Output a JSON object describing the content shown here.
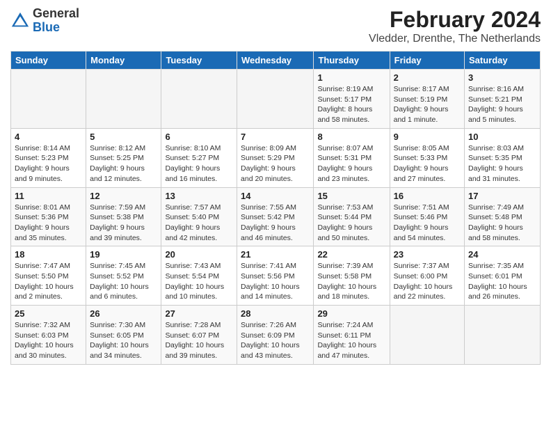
{
  "header": {
    "logo_general": "General",
    "logo_blue": "Blue",
    "title": "February 2024",
    "subtitle": "Vledder, Drenthe, The Netherlands"
  },
  "calendar": {
    "columns": [
      "Sunday",
      "Monday",
      "Tuesday",
      "Wednesday",
      "Thursday",
      "Friday",
      "Saturday"
    ],
    "weeks": [
      [
        {
          "day": "",
          "info": ""
        },
        {
          "day": "",
          "info": ""
        },
        {
          "day": "",
          "info": ""
        },
        {
          "day": "",
          "info": ""
        },
        {
          "day": "1",
          "info": "Sunrise: 8:19 AM\nSunset: 5:17 PM\nDaylight: 8 hours\nand 58 minutes."
        },
        {
          "day": "2",
          "info": "Sunrise: 8:17 AM\nSunset: 5:19 PM\nDaylight: 9 hours\nand 1 minute."
        },
        {
          "day": "3",
          "info": "Sunrise: 8:16 AM\nSunset: 5:21 PM\nDaylight: 9 hours\nand 5 minutes."
        }
      ],
      [
        {
          "day": "4",
          "info": "Sunrise: 8:14 AM\nSunset: 5:23 PM\nDaylight: 9 hours\nand 9 minutes."
        },
        {
          "day": "5",
          "info": "Sunrise: 8:12 AM\nSunset: 5:25 PM\nDaylight: 9 hours\nand 12 minutes."
        },
        {
          "day": "6",
          "info": "Sunrise: 8:10 AM\nSunset: 5:27 PM\nDaylight: 9 hours\nand 16 minutes."
        },
        {
          "day": "7",
          "info": "Sunrise: 8:09 AM\nSunset: 5:29 PM\nDaylight: 9 hours\nand 20 minutes."
        },
        {
          "day": "8",
          "info": "Sunrise: 8:07 AM\nSunset: 5:31 PM\nDaylight: 9 hours\nand 23 minutes."
        },
        {
          "day": "9",
          "info": "Sunrise: 8:05 AM\nSunset: 5:33 PM\nDaylight: 9 hours\nand 27 minutes."
        },
        {
          "day": "10",
          "info": "Sunrise: 8:03 AM\nSunset: 5:35 PM\nDaylight: 9 hours\nand 31 minutes."
        }
      ],
      [
        {
          "day": "11",
          "info": "Sunrise: 8:01 AM\nSunset: 5:36 PM\nDaylight: 9 hours\nand 35 minutes."
        },
        {
          "day": "12",
          "info": "Sunrise: 7:59 AM\nSunset: 5:38 PM\nDaylight: 9 hours\nand 39 minutes."
        },
        {
          "day": "13",
          "info": "Sunrise: 7:57 AM\nSunset: 5:40 PM\nDaylight: 9 hours\nand 42 minutes."
        },
        {
          "day": "14",
          "info": "Sunrise: 7:55 AM\nSunset: 5:42 PM\nDaylight: 9 hours\nand 46 minutes."
        },
        {
          "day": "15",
          "info": "Sunrise: 7:53 AM\nSunset: 5:44 PM\nDaylight: 9 hours\nand 50 minutes."
        },
        {
          "day": "16",
          "info": "Sunrise: 7:51 AM\nSunset: 5:46 PM\nDaylight: 9 hours\nand 54 minutes."
        },
        {
          "day": "17",
          "info": "Sunrise: 7:49 AM\nSunset: 5:48 PM\nDaylight: 9 hours\nand 58 minutes."
        }
      ],
      [
        {
          "day": "18",
          "info": "Sunrise: 7:47 AM\nSunset: 5:50 PM\nDaylight: 10 hours\nand 2 minutes."
        },
        {
          "day": "19",
          "info": "Sunrise: 7:45 AM\nSunset: 5:52 PM\nDaylight: 10 hours\nand 6 minutes."
        },
        {
          "day": "20",
          "info": "Sunrise: 7:43 AM\nSunset: 5:54 PM\nDaylight: 10 hours\nand 10 minutes."
        },
        {
          "day": "21",
          "info": "Sunrise: 7:41 AM\nSunset: 5:56 PM\nDaylight: 10 hours\nand 14 minutes."
        },
        {
          "day": "22",
          "info": "Sunrise: 7:39 AM\nSunset: 5:58 PM\nDaylight: 10 hours\nand 18 minutes."
        },
        {
          "day": "23",
          "info": "Sunrise: 7:37 AM\nSunset: 6:00 PM\nDaylight: 10 hours\nand 22 minutes."
        },
        {
          "day": "24",
          "info": "Sunrise: 7:35 AM\nSunset: 6:01 PM\nDaylight: 10 hours\nand 26 minutes."
        }
      ],
      [
        {
          "day": "25",
          "info": "Sunrise: 7:32 AM\nSunset: 6:03 PM\nDaylight: 10 hours\nand 30 minutes."
        },
        {
          "day": "26",
          "info": "Sunrise: 7:30 AM\nSunset: 6:05 PM\nDaylight: 10 hours\nand 34 minutes."
        },
        {
          "day": "27",
          "info": "Sunrise: 7:28 AM\nSunset: 6:07 PM\nDaylight: 10 hours\nand 39 minutes."
        },
        {
          "day": "28",
          "info": "Sunrise: 7:26 AM\nSunset: 6:09 PM\nDaylight: 10 hours\nand 43 minutes."
        },
        {
          "day": "29",
          "info": "Sunrise: 7:24 AM\nSunset: 6:11 PM\nDaylight: 10 hours\nand 47 minutes."
        },
        {
          "day": "",
          "info": ""
        },
        {
          "day": "",
          "info": ""
        }
      ]
    ]
  }
}
